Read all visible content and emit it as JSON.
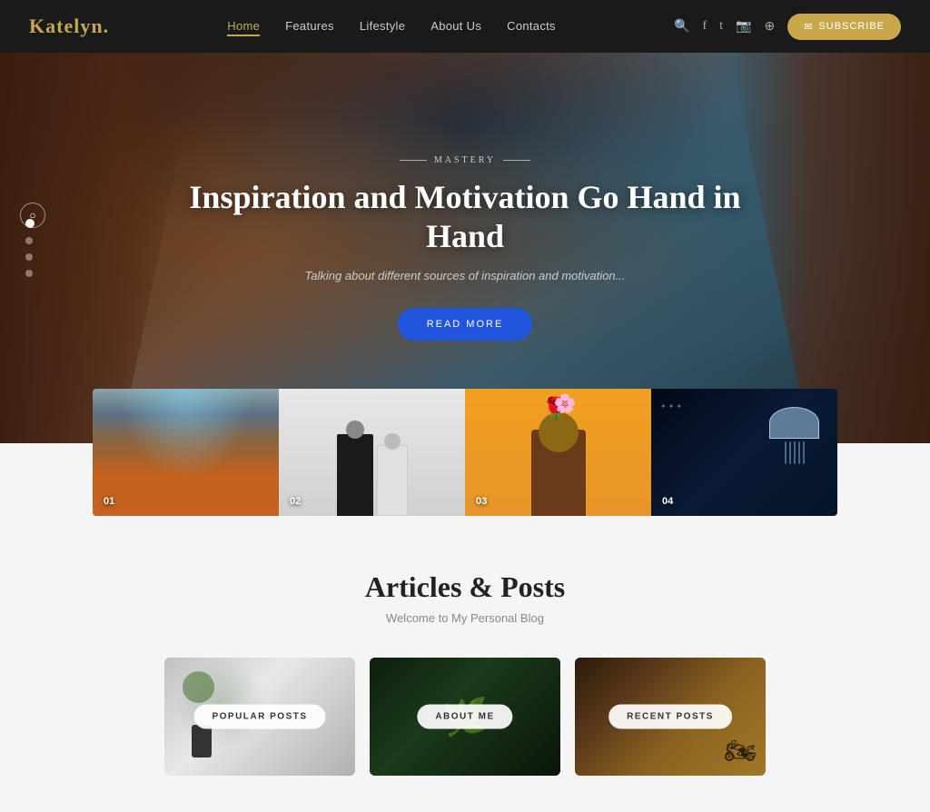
{
  "site": {
    "logo_text": "Katelyn",
    "logo_dot": "."
  },
  "nav": {
    "items": [
      {
        "label": "Home",
        "active": true
      },
      {
        "label": "Features",
        "active": false
      },
      {
        "label": "Lifestyle",
        "active": false
      },
      {
        "label": "About Us",
        "active": false
      },
      {
        "label": "Contacts",
        "active": false
      }
    ],
    "subscribe_label": "SUBSCRIBE"
  },
  "hero": {
    "label": "MASTERY",
    "title": "Inspiration and Motivation Go Hand in Hand",
    "subtitle": "Talking about different sources of inspiration and motivation...",
    "btn_label": "READ MORE"
  },
  "thumbnails": [
    {
      "num": "01"
    },
    {
      "num": "02"
    },
    {
      "num": "03"
    },
    {
      "num": "04"
    }
  ],
  "articles": {
    "title": "Articles & Posts",
    "subtitle": "Welcome to My Personal Blog",
    "cards": [
      {
        "label": "POPULAR POSTS"
      },
      {
        "label": "ABOUT ME"
      },
      {
        "label": "RECENT POSTS"
      }
    ]
  },
  "colors": {
    "accent": "#c8a84b",
    "blue_btn": "#2255dd",
    "nav_bg": "#1a1a1a"
  }
}
